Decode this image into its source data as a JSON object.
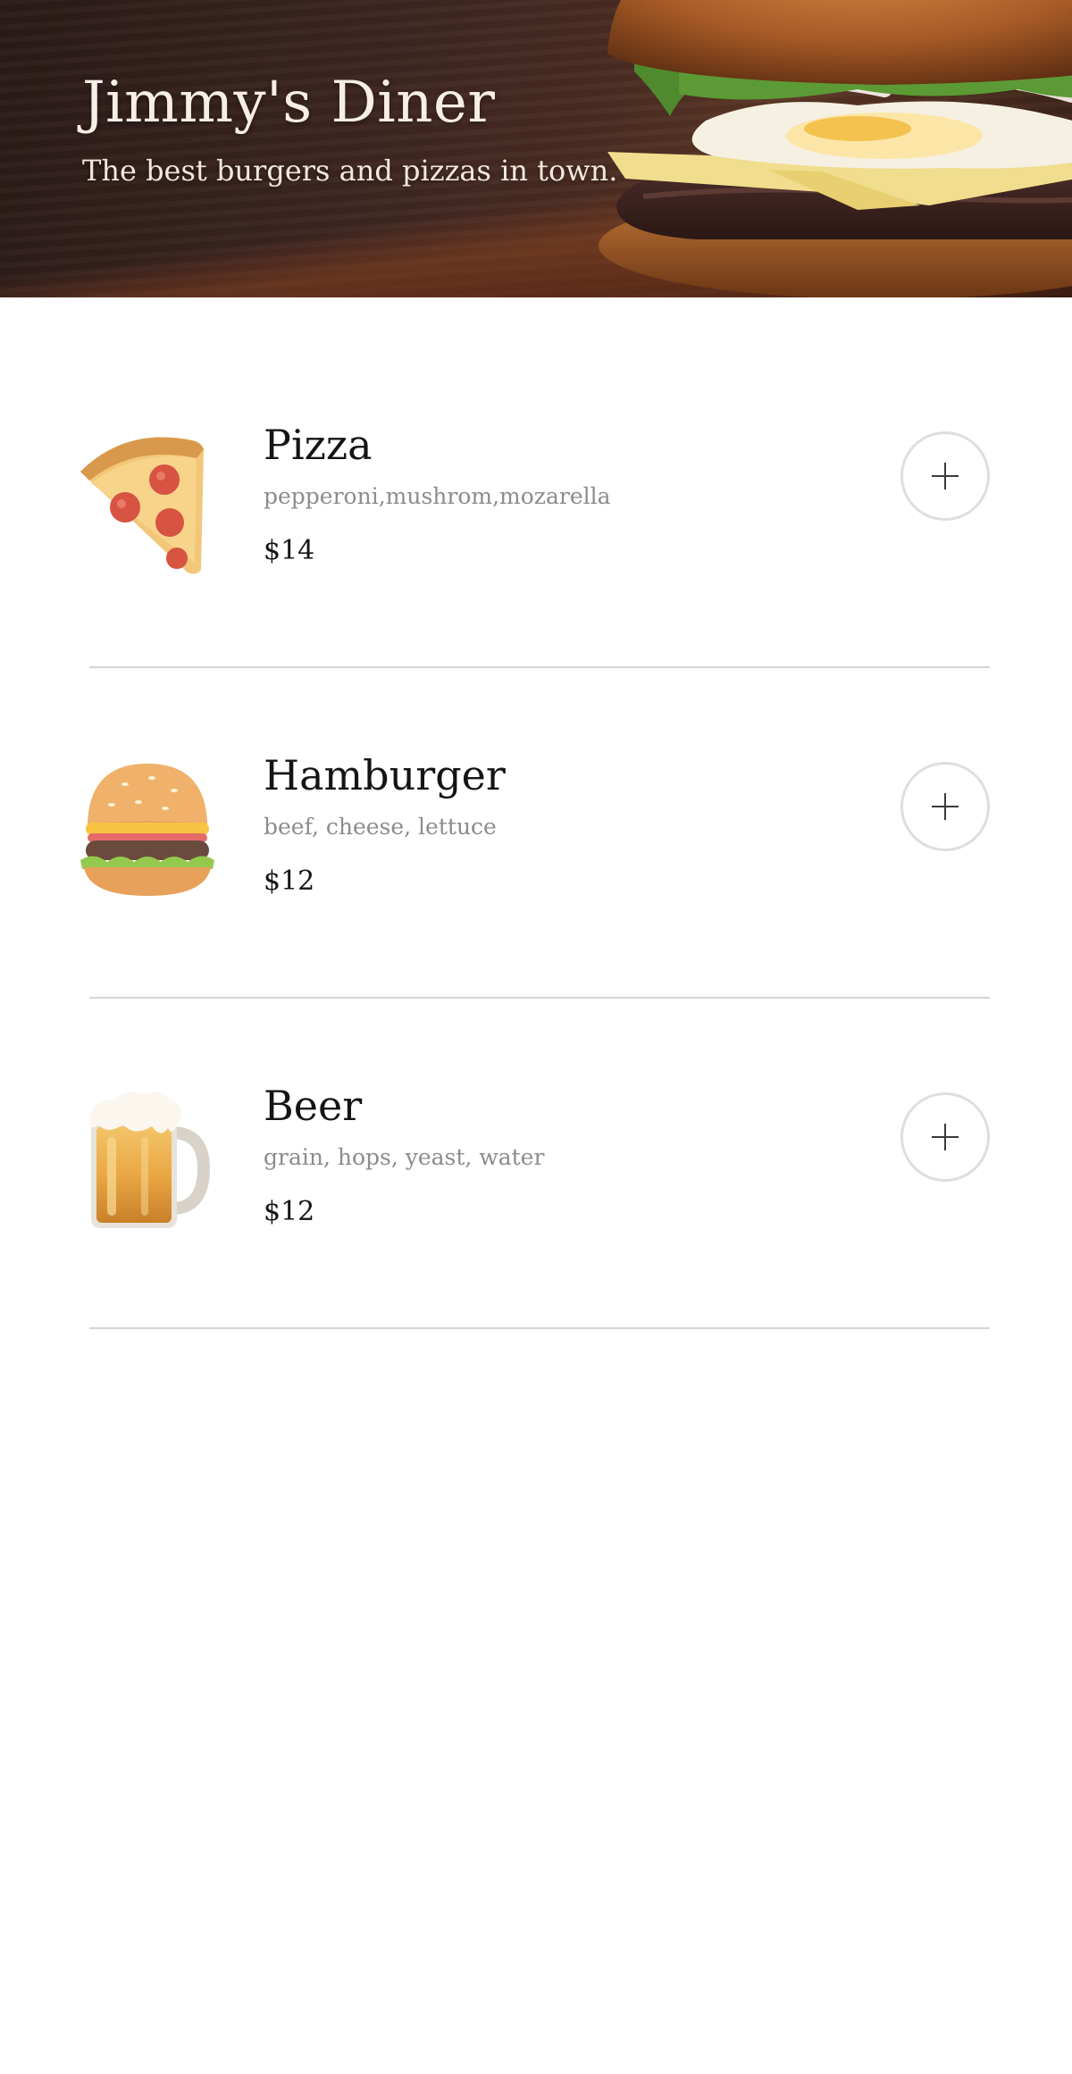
{
  "header": {
    "title": "Jimmy's Diner",
    "subtitle": "The best burgers and pizzas in town.",
    "background_image": "burger-photo"
  },
  "menu": {
    "items": [
      {
        "icon": "pizza-slice-icon",
        "name": "Pizza",
        "ingredients": "pepperoni,mushrom,mozarella",
        "price": "$14"
      },
      {
        "icon": "hamburger-icon",
        "name": "Hamburger",
        "ingredients": "beef, cheese, lettuce",
        "price": "$12"
      },
      {
        "icon": "beer-mug-icon",
        "name": "Beer",
        "ingredients": "grain, hops, yeast, water",
        "price": "$12"
      }
    ]
  },
  "colors": {
    "header_dark": "#2a1b18",
    "title_text": "#f7efe6",
    "item_name": "#141414",
    "ingredients": "#8c8c8c",
    "button_border": "#dedede",
    "divider": "#d4d4d4"
  }
}
